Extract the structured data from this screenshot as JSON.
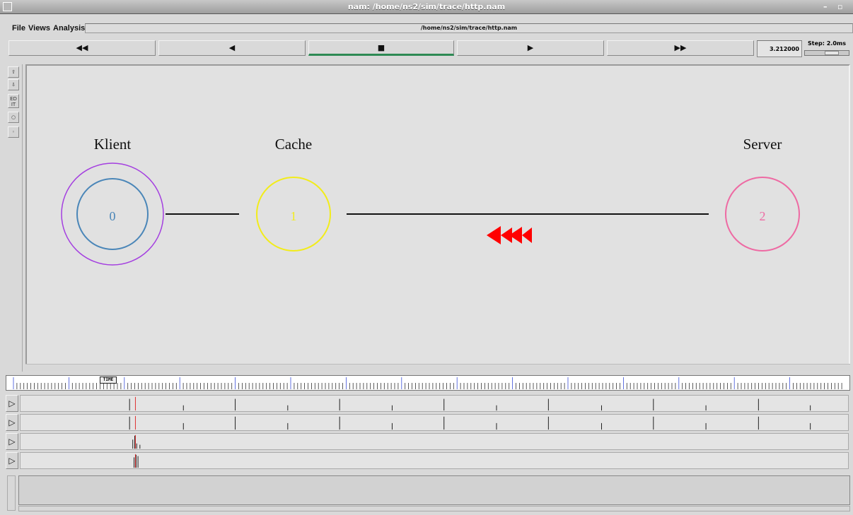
{
  "window": {
    "title": "nam: /home/ns2/sim/trace/http.nam",
    "minimize": "–",
    "maximize": "▫"
  },
  "menu": {
    "file": "File",
    "views": "Views",
    "analysis": "Analysis"
  },
  "path": "/home/ns2/sim/trace/http.nam",
  "transport": {
    "fast_rewind": "◀◀",
    "rewind": "◀",
    "stop": "■",
    "play": "▶",
    "fast_forward": "▶▶"
  },
  "time": "3.212000",
  "step": {
    "label": "Step: 2.0ms",
    "level": 0.55
  },
  "tools": {
    "edit": "ED IT"
  },
  "nodes": [
    {
      "id": "0",
      "label": "Klient",
      "color": "#4a86b8",
      "ring_color": "#a43fe0"
    },
    {
      "id": "1",
      "label": "Cache",
      "color": "#f2ec1a"
    },
    {
      "id": "2",
      "label": "Server",
      "color": "#ee6aa3"
    }
  ],
  "packet_color": "#ff0000",
  "timeline": {
    "marker": "TIME"
  }
}
